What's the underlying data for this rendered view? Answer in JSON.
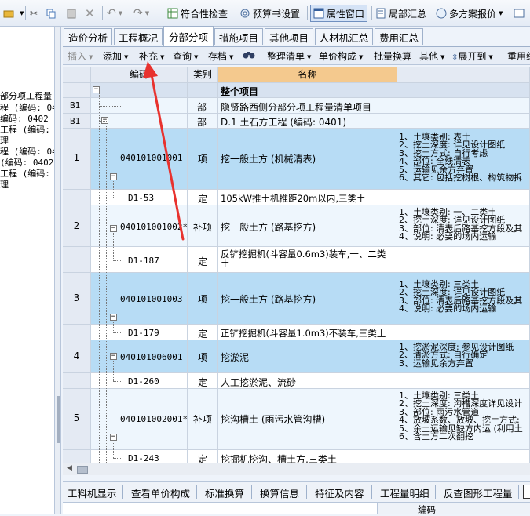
{
  "toolbar": {
    "items": [
      {
        "label": "符合性检查"
      },
      {
        "label": "预算书设置"
      },
      {
        "label": "属性窗口"
      },
      {
        "label": "局部汇总"
      },
      {
        "label": "多方案报价"
      }
    ]
  },
  "left_panel": {
    "lines": [
      "部分项工程量",
      "程 (编码: 04",
      "编码: 0402",
      "工程 (编码: 0",
      "理",
      "程 (编码: 04",
      "(编码: 0402",
      "工程 (编码: 0",
      "理"
    ]
  },
  "tabs": [
    "造价分析",
    "工程概况",
    "分部分项",
    "措施项目",
    "其他项目",
    "人材机汇总",
    "费用汇总"
  ],
  "sub_toolbar": {
    "insert": "插入",
    "add": "添加",
    "supplement": "补充",
    "query": "查询",
    "archive": "存档",
    "organize": "整理清单",
    "unit_price": "单价构成",
    "batch_convert": "批量换算",
    "other": "其他",
    "expand": "展开到",
    "reuse": "重用组"
  },
  "grid": {
    "headers": {
      "code": "编码",
      "type": "类别",
      "name": "名称"
    },
    "rows": [
      {
        "index": "",
        "code": "",
        "type": "",
        "name": "整个项目",
        "features": ""
      },
      {
        "index": "B1",
        "code": "",
        "type": "部",
        "name": "隐贤路西侧分部分项工程量清单项目",
        "features": ""
      },
      {
        "index": "B1",
        "code": "",
        "type": "部",
        "name": "D.1  土石方工程 (编码: 0401)",
        "features": ""
      },
      {
        "index": "1",
        "code": "040101001001",
        "type": "项",
        "name": "挖一般土方 (机械清表)",
        "features": "1、土壤类别: 表土\n2、挖土深度: 详见设计图纸\n3、挖土方式: 自行考虑\n4、部位: 全线清表\n5、运输见余方弃置\n6、其它: 包括挖树根、构筑物拆"
      },
      {
        "index": "",
        "code": "D1-53",
        "type": "定",
        "name": "105kW推土机推距20m以内,三类土",
        "features": ""
      },
      {
        "index": "2",
        "code": "040101001002*",
        "type": "补项",
        "name": "挖一般土方 (路基挖方)",
        "features": "1、土壤类别: 一、二类土\n2、挖土深度: 详见设计图纸\n3、部位: 清表后路基挖方段及其\n4、说明: 必要的场内运输"
      },
      {
        "index": "",
        "code": "D1-187",
        "type": "定",
        "name": "反铲挖掘机(斗容量0.6m3)装车,一、二类土",
        "features": ""
      },
      {
        "index": "3",
        "code": "040101001003",
        "type": "项",
        "name": "挖一般土方 (路基挖方)",
        "features": "1、土壤类别: 三类土\n2、挖土深度: 详见设计图纸\n3、部位: 清表后路基挖方段及其\n4、说明: 必要的场内运输"
      },
      {
        "index": "",
        "code": "D1-179",
        "type": "定",
        "name": "正铲挖掘机(斗容量1.0m3)不装车,三类土",
        "features": ""
      },
      {
        "index": "4",
        "code": "040101006001",
        "type": "项",
        "name": "挖淤泥",
        "features": "1、挖淤泥深度: 参见设计图纸\n2、清淤方式: 自行确定\n3、运输见余方弃置"
      },
      {
        "index": "",
        "code": "D1-260",
        "type": "定",
        "name": "人工挖淤泥、流砂",
        "features": ""
      },
      {
        "index": "5",
        "code": "040101002001*",
        "type": "补项",
        "name": "挖沟槽土 (雨污水管沟槽)",
        "features": "1、土壤类别: 三类土\n2、挖土深度: 沟槽深度详见设计\n3、部位: 雨污水管道\n4、放坡系数、放坡、挖土方式:\n5、余土运输见缺方内运 (利用土\n6、含土方二次翻挖"
      },
      {
        "index": "",
        "code": "D1-243",
        "type": "定",
        "name": "挖掘机挖沟、槽土方,三类土",
        "features": ""
      }
    ]
  },
  "bottom_tabs": [
    "工料机显示",
    "查看单价构成",
    "标准换算",
    "换算信息",
    "特征及内容",
    "工程量明细",
    "反查图形工程量"
  ],
  "bottom_panel": {
    "code_header": "编码"
  },
  "colors": {
    "selected_row": "#b7dcf5",
    "sub_row": "#eef6fd",
    "accent_arrow": "#e8322e"
  }
}
